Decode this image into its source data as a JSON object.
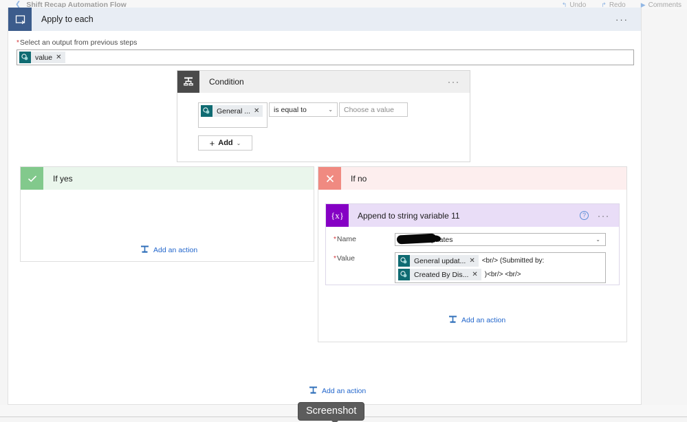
{
  "topbar": {
    "back_icon": "chevron-left-icon",
    "flow_title": "Shift Recap Automation Flow",
    "actions": [
      {
        "glyph": "↰",
        "label": "Undo"
      },
      {
        "glyph": "↱",
        "label": "Redo"
      },
      {
        "glyph": "▶",
        "label": "Comments"
      }
    ]
  },
  "apply_to_each": {
    "icon": "loop-icon",
    "title": "Apply to each",
    "ellipsis": "···",
    "field_label": "Select an output from previous steps",
    "required_marker": "*",
    "token": {
      "icon": "sharepoint-icon",
      "label": "value",
      "remove": "✕"
    }
  },
  "condition": {
    "icon": "condition-branch-icon",
    "title": "Condition",
    "ellipsis": "···",
    "left_token": {
      "icon": "sharepoint-icon",
      "label": "General ...",
      "remove": "✕"
    },
    "operator": "is equal to",
    "operator_chevron": "⌄",
    "value_placeholder": "Choose a value",
    "add_button": {
      "plus": "+",
      "label": "Add",
      "chevron": "⌄"
    }
  },
  "branches": {
    "yes": {
      "badge_icon": "check-icon",
      "title": "If yes",
      "add_action": {
        "icon": "add-action-icon",
        "label": "Add an action"
      }
    },
    "no": {
      "badge_icon": "close-x-icon",
      "title": "If no",
      "add_action": {
        "icon": "add-action-icon",
        "label": "Add an action"
      }
    }
  },
  "append_action": {
    "icon": "variable-braces-icon",
    "icon_text": "{x}",
    "title": "Append to string variable 11",
    "help_icon": "help-question-icon",
    "help_glyph": "?",
    "ellipsis": "···",
    "name": {
      "label": "Name",
      "required_marker": "*",
      "value": "GeneralUpdates",
      "redacted": true,
      "chevron": "⌄"
    },
    "value": {
      "label": "Value",
      "required_marker": "*",
      "lines": [
        {
          "token": {
            "icon": "sharepoint-icon",
            "label": "General updat...",
            "remove": "✕"
          },
          "text": "<br/> (Submitted by:"
        },
        {
          "token": {
            "icon": "sharepoint-icon",
            "label": "Created By Dis...",
            "remove": "✕"
          },
          "text": ")<br/> <br/>"
        }
      ]
    }
  },
  "bottom_add_action": {
    "icon": "add-action-icon",
    "label": "Add an action"
  },
  "tooltip": {
    "text": "Screenshot"
  },
  "colors": {
    "apply_to_each_header": "#e8edf4",
    "apply_to_each_icon": "#3c5c8c",
    "condition_icon": "#4a4a4a",
    "yes_badge": "#82c98c",
    "no_badge": "#f08a81",
    "variable_icon": "#8500c4",
    "variable_header": "#e9ddf7",
    "sharepoint_token": "#0f6b72",
    "link_blue": "#2266cc",
    "required_red": "#d13438"
  }
}
